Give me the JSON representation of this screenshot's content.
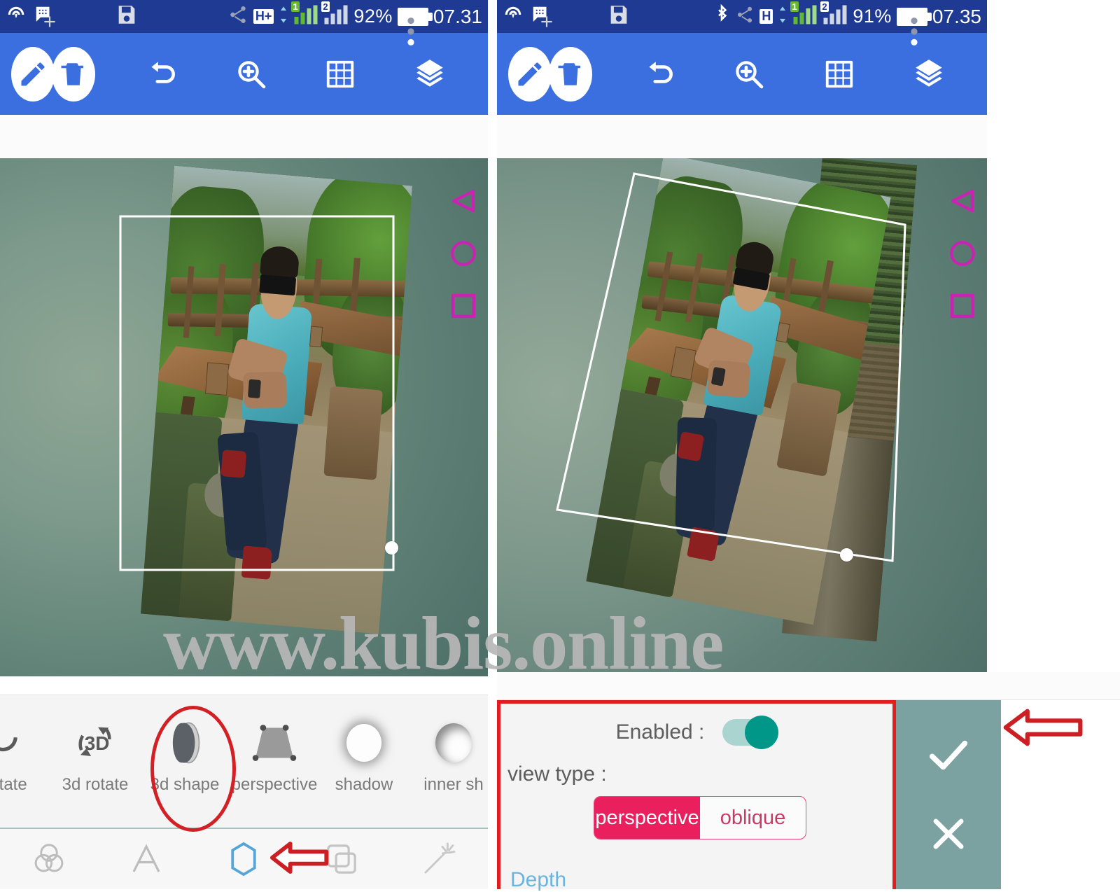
{
  "page": {
    "watermark": "www.kubis.online"
  },
  "left_panel": {
    "statusbar": {
      "battery_percent": "92%",
      "time": "07.31",
      "network_label": "H+",
      "sim1_label": "1",
      "sim2_label": "2",
      "icons": [
        "cast-icon",
        "message-icon",
        "save-icon",
        "share-icon",
        "signal-icon",
        "battery-icon",
        "more-vert-icon"
      ]
    },
    "toolbar": {
      "items": [
        "edit-icon",
        "delete-icon",
        "undo-icon",
        "zoom-in-icon",
        "grid-icon",
        "layers-icon"
      ]
    },
    "canvas": {
      "shape_rail": [
        "triangle-shape-icon",
        "circle-shape-icon",
        "square-shape-icon"
      ]
    },
    "effects": [
      {
        "label": "rotate",
        "icon": "rotate-icon"
      },
      {
        "label": "3d rotate",
        "icon": "3d-rotate-icon"
      },
      {
        "label": "3d shape",
        "icon": "3d-shape-icon"
      },
      {
        "label": "perspective",
        "icon": "perspective-icon"
      },
      {
        "label": "shadow",
        "icon": "shadow-icon"
      },
      {
        "label": "inner sh",
        "icon": "inner-shadow-icon"
      }
    ],
    "nav": [
      {
        "icon": "blend-icon",
        "selected": false
      },
      {
        "icon": "text-icon",
        "selected": false
      },
      {
        "icon": "shape-hexagon-icon",
        "selected": true
      },
      {
        "icon": "duplicate-icon",
        "selected": false
      },
      {
        "icon": "magic-wand-icon",
        "selected": false
      }
    ],
    "annotation": {
      "circle_target": "3d shape",
      "arrow_target": "shape-hexagon-icon"
    }
  },
  "right_panel": {
    "statusbar": {
      "battery_percent": "91%",
      "time": "07.35",
      "network_label": "H",
      "sim1_label": "1",
      "sim2_label": "2",
      "icons": [
        "cast-icon",
        "message-icon",
        "save-icon",
        "bluetooth-icon",
        "share-icon",
        "signal-icon",
        "battery-icon",
        "more-vert-icon"
      ]
    },
    "toolbar": {
      "items": [
        "edit-icon",
        "delete-icon",
        "undo-icon",
        "zoom-in-icon",
        "grid-icon",
        "layers-icon"
      ]
    },
    "canvas": {
      "shape_rail": [
        "triangle-shape-icon",
        "circle-shape-icon",
        "square-shape-icon"
      ]
    },
    "dialog": {
      "enabled_label": "Enabled :",
      "enabled_value": true,
      "viewtype_label": "view type :",
      "viewtype_options": [
        "perspective",
        "oblique"
      ],
      "viewtype_selected": "perspective",
      "depth_label": "Depth",
      "confirm_icon": "check-icon",
      "cancel_icon": "close-icon"
    },
    "annotation": {
      "arrow_target": "check-icon"
    }
  },
  "colors": {
    "statusbar_bg": "#1f3a93",
    "toolbar_bg": "#3b6fe0",
    "shape_magenta": "#cc22b4",
    "annotation_red": "#d32024",
    "toggle_on": "#009688",
    "segment_active": "#ea1f5e",
    "confirm_col_bg": "#7ba2a1",
    "depth_label": "#6ab4e0",
    "selected_nav": "#55a5d8"
  }
}
